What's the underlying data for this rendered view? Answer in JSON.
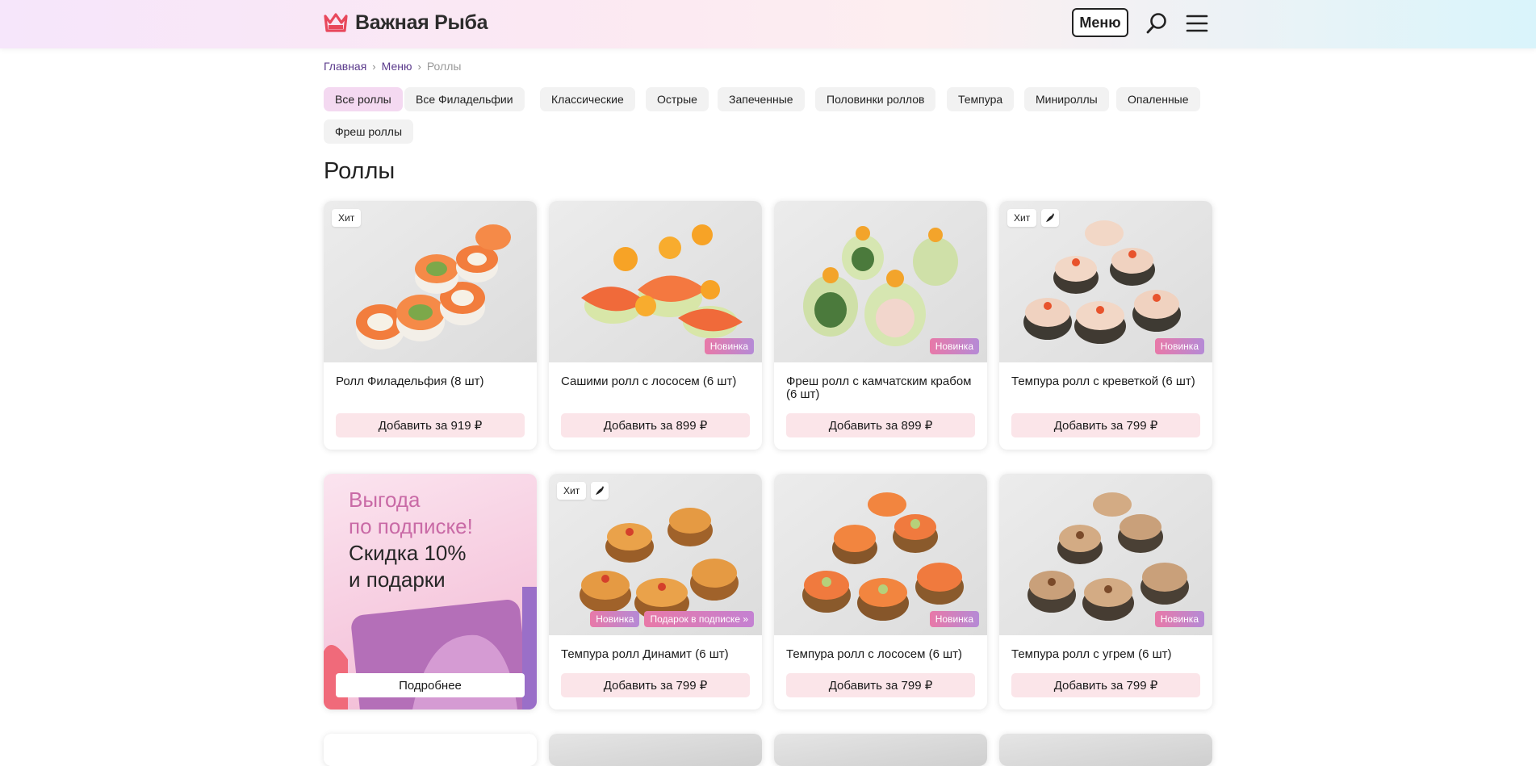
{
  "header": {
    "logo_text": "Важная Рыба",
    "menu_label": "Меню"
  },
  "breadcrumb": {
    "home": "Главная",
    "menu": "Меню",
    "current": "Роллы"
  },
  "filters": [
    {
      "label": "Все роллы",
      "active": true
    },
    {
      "label": "Все Филадельфии"
    },
    {
      "label": "Классические"
    },
    {
      "label": "Острые"
    },
    {
      "label": "Запеченные"
    },
    {
      "label": "Половинки роллов"
    },
    {
      "label": "Темпура"
    },
    {
      "label": "Минироллы"
    },
    {
      "label": "Опаленные"
    },
    {
      "label": "Фреш роллы"
    }
  ],
  "page_title": "Роллы",
  "products": [
    {
      "name": "Ролл Филадельфия (8 шт)",
      "add_label": "Добавить за 919 ₽",
      "tag_hit": "Хит",
      "image": "salmon-roll-image"
    },
    {
      "name": "Сашими ролл с лососем (6 шт)",
      "add_label": "Добавить за 899 ₽",
      "badge_new": "Новинка",
      "image": "sashimi-roll-image"
    },
    {
      "name": "Фреш ролл с камчатским крабом (6 шт)",
      "add_label": "Добавить за 899 ₽",
      "badge_new": "Новинка",
      "image": "fresh-roll-image"
    },
    {
      "name": "Темпура ролл с креветкой (6 шт)",
      "add_label": "Добавить за 799 ₽",
      "tag_hit": "Хит",
      "spicy": true,
      "badge_new": "Новинка",
      "image": "tempura-roll-image"
    },
    {
      "name": "Темпура ролл Динамит (6 шт)",
      "add_label": "Добавить за 799 ₽",
      "tag_hit": "Хит",
      "spicy": true,
      "badge_new": "Новинка",
      "badge_gift": "Подарок в подписке »",
      "image": "tempura-roll-image"
    },
    {
      "name": "Темпура ролл с лососем (6 шт)",
      "add_label": "Добавить за 799 ₽",
      "badge_new": "Новинка",
      "image": "tempura-roll-image"
    },
    {
      "name": "Темпура ролл с угрем (6 шт)",
      "add_label": "Добавить за 799 ₽",
      "badge_new": "Новинка",
      "image": "tempura-roll-image"
    }
  ],
  "promo": {
    "line1": "Выгода",
    "line2": "по подписке!",
    "line3": "Скидка 10%",
    "line4": "и подарки",
    "button": "Подробнее"
  },
  "colors": {
    "accent": "#e8485c",
    "chip_active": "#f4d9f1",
    "add_button": "#fbe5e9",
    "breadcrumb_link": "#5b3b8c",
    "promo_pink": "#c96aa6"
  },
  "icons": [
    "crown-icon",
    "search-icon",
    "burger-menu-icon",
    "chevron-right-icon",
    "chili-pepper-icon"
  ]
}
